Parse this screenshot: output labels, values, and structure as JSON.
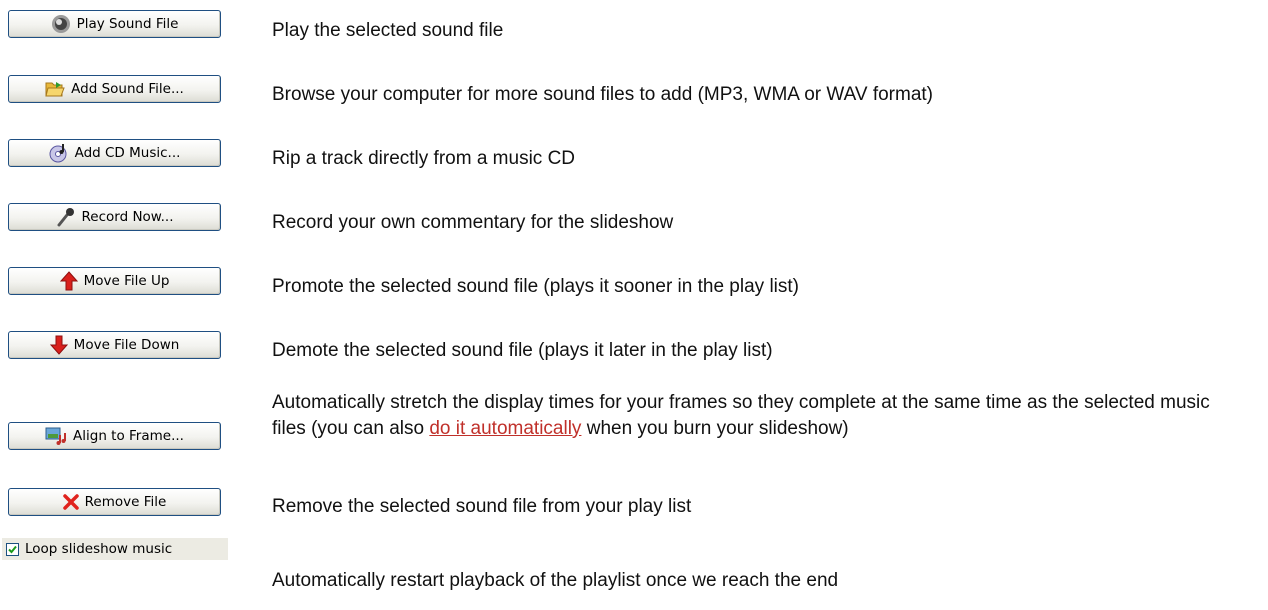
{
  "rows": [
    {
      "button": "Play Sound File",
      "icon": "speaker-icon",
      "description": "Play the selected sound file"
    },
    {
      "button": "Add Sound File...",
      "icon": "folder-open-icon",
      "description": "Browse your computer for more sound files to add (MP3, WMA or WAV format)"
    },
    {
      "button": "Add CD Music...",
      "icon": "cd-icon",
      "description": "Rip a track directly from a music CD"
    },
    {
      "button": "Record Now...",
      "icon": "microphone-icon",
      "description": "Record your own commentary for the slideshow"
    },
    {
      "button": "Move File Up",
      "icon": "arrow-up-icon",
      "description": "Promote the selected sound file (plays it sooner in the play list)"
    },
    {
      "button": "Move File Down",
      "icon": "arrow-down-icon",
      "description": "Demote the selected sound file (plays it later in the play list)"
    },
    {
      "button": "Align to Frame...",
      "icon": "align-frame-icon",
      "description_before": "Automatically stretch the display times for your frames so they complete at the same time as the selected music files (you can also ",
      "description_link": "do it automatically",
      "description_after": " when you burn your slideshow)"
    },
    {
      "button": "Remove File",
      "icon": "remove-x-icon",
      "description": "Remove the selected sound file from your play list"
    }
  ],
  "loop": {
    "label": "Loop slideshow music",
    "checked": true,
    "description": "Automatically restart playback of the playlist once we reach the end"
  },
  "colors": {
    "link": "#c0302a",
    "button_border": "#1f4f82",
    "checkbox_bg": "#ecebe3"
  }
}
